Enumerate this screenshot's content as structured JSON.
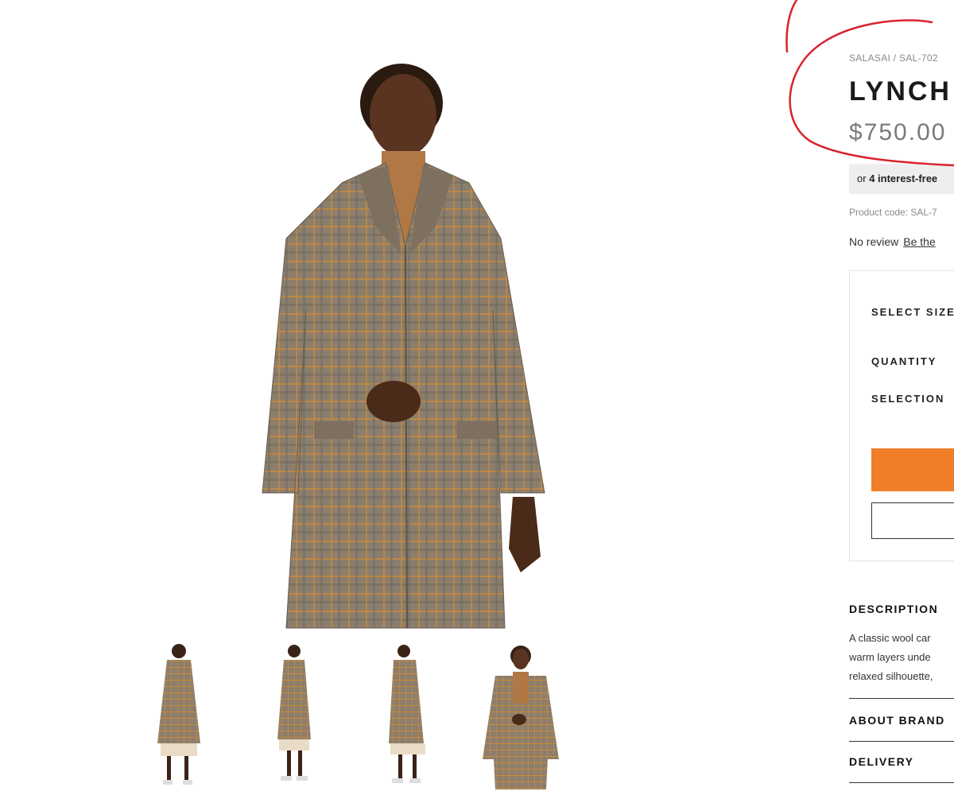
{
  "product": {
    "breadcrumb": "SALASAI / SAL-702",
    "title": "LYNCH",
    "price": "$750.00",
    "installments_prefix": "or",
    "installments_bold": "4 interest-free",
    "product_code": "Product code: SAL-7",
    "review_text": "No review",
    "review_link": "Be the"
  },
  "options": {
    "select_size_label": "SELECT SIZE",
    "quantity_label": "QUANTITY",
    "selection_label": "SELECTION",
    "add_button_color": "#f07e28"
  },
  "sections": {
    "description_label": "DESCRIPTION",
    "description_lines": [
      "A classic wool car",
      "warm layers unde",
      "relaxed silhouette,"
    ],
    "about_brand_label": "ABOUT BRAND",
    "delivery_label": "DELIVERY"
  },
  "colors": {
    "annotation": "#d9232d",
    "coat_base": "#8c7e6c",
    "plaid_orange": "#c98a3e"
  },
  "thumbnails": [
    {
      "icon": "model-front-thumbnail"
    },
    {
      "icon": "model-side-thumbnail"
    },
    {
      "icon": "model-back-thumbnail"
    },
    {
      "icon": "model-closeup-thumbnail"
    }
  ]
}
